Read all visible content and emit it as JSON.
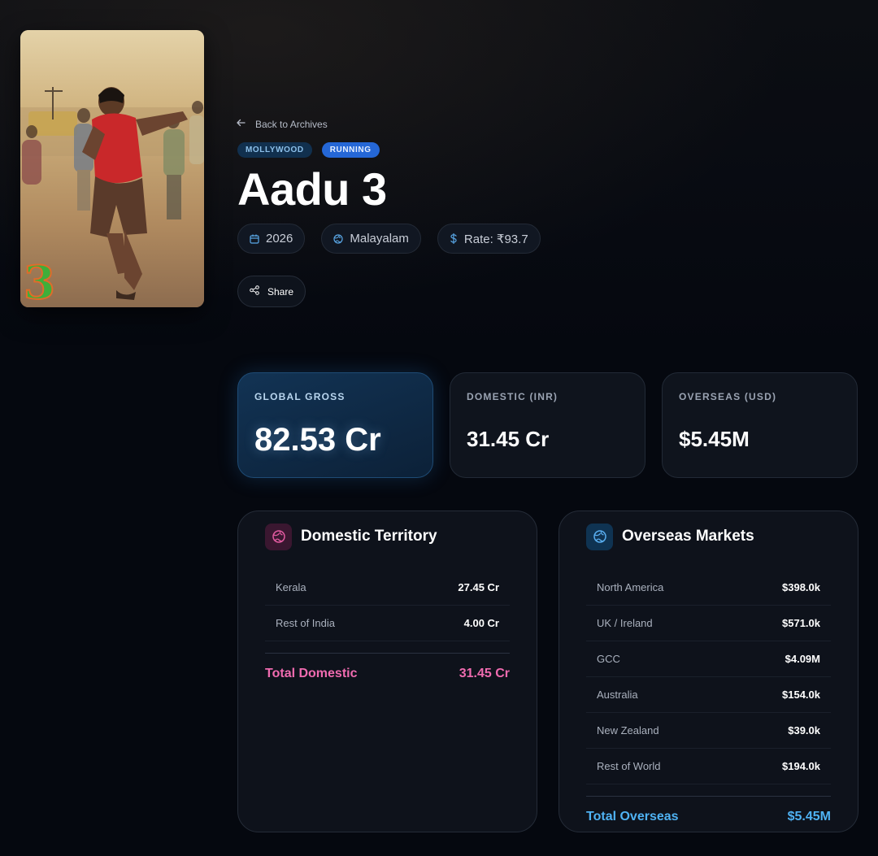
{
  "movie": {
    "title": "Aadu 3",
    "back_label": "Back to Archives",
    "genre_badge": "MOLLYWOOD",
    "status_badge": "RUNNING",
    "year": "2026",
    "language": "Malayalam",
    "rate": "Rate: ₹93.7",
    "share_label": "Share"
  },
  "stats": {
    "global": {
      "label": "GLOBAL GROSS",
      "value": "82.53 Cr"
    },
    "domestic": {
      "label": "DOMESTIC (INR)",
      "value": "31.45 Cr"
    },
    "overseas": {
      "label": "OVERSEAS (USD)",
      "value": "$5.45M"
    }
  },
  "domestic_panel": {
    "title": "Domestic Territory",
    "rows": [
      {
        "name": "Kerala",
        "value": "27.45 Cr"
      },
      {
        "name": "Rest of India",
        "value": "4.00 Cr"
      }
    ],
    "total_label": "Total Domestic",
    "total_value": "31.45 Cr"
  },
  "overseas_panel": {
    "title": "Overseas Markets",
    "rows": [
      {
        "name": "North America",
        "value": "$398.0k"
      },
      {
        "name": "UK / Ireland",
        "value": "$571.0k"
      },
      {
        "name": "GCC",
        "value": "$4.09M"
      },
      {
        "name": "Australia",
        "value": "$154.0k"
      },
      {
        "name": "New Zealand",
        "value": "$39.0k"
      },
      {
        "name": "Rest of World",
        "value": "$194.0k"
      }
    ],
    "total_label": "Total Overseas",
    "total_value": "$5.45M"
  },
  "colors": {
    "accent_blue": "#2567d6",
    "domestic_pink": "#f06bb0",
    "overseas_blue": "#4fb2f3",
    "background": "#05080f"
  },
  "icons": {
    "back": "arrow-left-icon",
    "year": "calendar-icon",
    "language": "globe-icon",
    "rate": "dollar-icon",
    "share": "share-icon",
    "domestic": "globe-icon",
    "overseas": "globe-icon"
  }
}
